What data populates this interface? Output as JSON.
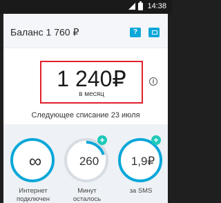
{
  "status_bar": {
    "time": "14:38"
  },
  "header": {
    "balance": "Баланс 1 760 ₽",
    "help_icon_label": "?"
  },
  "plan": {
    "price": "1 240₽",
    "period": "в месяц",
    "next_charge": "Следующее списание 23 июля",
    "info_icon_label": "i"
  },
  "usage": [
    {
      "value": "∞",
      "label_line1": "Интернет",
      "label_line2": "подключен"
    },
    {
      "value": "260",
      "label_line1": "Минут",
      "label_line2": "осталось",
      "remaining_fraction": 0.2
    },
    {
      "value": "1,9₽",
      "label_line1": "за SMS",
      "label_line2": ""
    }
  ],
  "plus_label": "+",
  "colors": {
    "accent": "#0aa7d9",
    "highlight": "#e0202a",
    "plus": "#1ec9b8"
  }
}
